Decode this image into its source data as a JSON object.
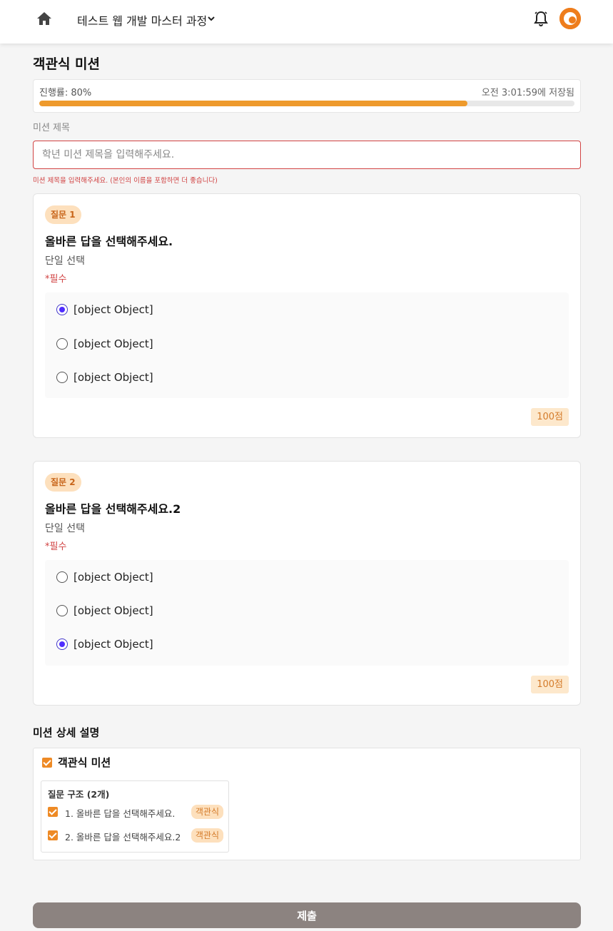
{
  "header": {
    "course_title": "테스트 웹 개발 마스터 과정",
    "icons": {
      "home": "home-icon",
      "dropdown": "chevron-down-icon",
      "notifications": "bell-icon",
      "profile": "avatar"
    }
  },
  "page": {
    "title": "객관식 미션"
  },
  "progress": {
    "label": "진행률: 80%",
    "percent": 80,
    "saved": "오전 3:01:59에 저장됨"
  },
  "mission_title": {
    "label": "미션 제목",
    "value": "",
    "placeholder": "학년 미션 제목을 입력해주세요.",
    "error": "미션 제목을 입력해주세요. (본인의 이름을 포함하면 더 좋습니다)"
  },
  "questions": [
    {
      "badge": "질문 1",
      "title": "올바른 답을 선택해주세요.",
      "type": "단일 선택",
      "required": "*필수",
      "options": [
        "[object Object]",
        "[object Object]",
        "[object Object]"
      ],
      "selected_index": 0,
      "points": "100점"
    },
    {
      "badge": "질문 2",
      "title": "올바른 답을 선택해주세요.2",
      "type": "단일 선택",
      "required": "*필수",
      "options": [
        "[object Object]",
        "[object Object]",
        "[object Object]"
      ],
      "selected_index": 2,
      "points": "100점"
    }
  ],
  "details": {
    "heading": "미션 상세 설명",
    "mission_type": "객관식 미션",
    "mission_type_checked": true,
    "structure_title": "질문 구조 (2개)",
    "items": [
      {
        "text": "1. 올바른 답을 선택해주세요.",
        "tag": "객관식",
        "checked": true
      },
      {
        "text": "2. 올바른 답을 선택해주세요.2",
        "tag": "객관식",
        "checked": true
      }
    ]
  },
  "submit": {
    "label": "제출"
  },
  "colors": {
    "accent": "#ee8a25",
    "radio_selected": "#4f2cff",
    "error": "#d14343",
    "submit_bg": "#8c8380"
  }
}
